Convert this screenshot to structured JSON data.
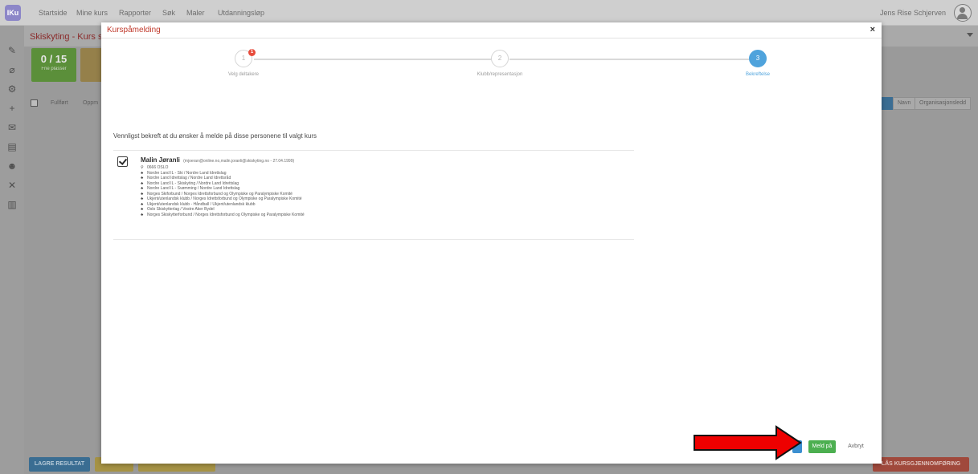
{
  "app": {
    "logo": "IKu",
    "nav": [
      "Startside",
      "Mine kurs",
      "Rapporter",
      "Søk",
      "Maler",
      "Utdanningsløp"
    ],
    "user_name": "Jens Rise Schjerven",
    "course_title": "Skiskyting - Kurs sikk"
  },
  "background": {
    "stat_value": "0 / 15",
    "stat_label": "Frie plasser",
    "filters": [
      "Fullført",
      "Oppm"
    ],
    "right_filters": [
      "Navn",
      "Organisasjonsledd"
    ],
    "save_button": "LAGRE RESULTAT",
    "lock_button": "LÅS KURSGJENNOMFØRING"
  },
  "modal": {
    "title": "Kurspåmelding",
    "close": "×",
    "steps": [
      {
        "number": "1",
        "label": "Velg deltakere",
        "badge": "1",
        "active": false
      },
      {
        "number": "2",
        "label": "Klubb/representasjon",
        "active": false
      },
      {
        "number": "3",
        "label": "Bekreftelse",
        "active": true
      }
    ],
    "confirm_text": "Vennligst bekreft at du ønsker å melde på disse personene til valgt kurs",
    "person": {
      "name": "Malin Jøranli",
      "meta": "(mjoeran@online.no,malin.joranli@skiskyting.no - 27.04.1999)",
      "address": "0666 OSLO",
      "memberships": [
        "Nordre Land IL - Ski / Nordre Land Idrettslag",
        "Nordre Land Idrettslag / Nordre Land Idrettsråd",
        "Nordre Land IL - Skiskyting / Nordre Land Idrettslag",
        "Nordre Land IL - Svømming / Nordre Land Idrettslag",
        "Norges Skiforbund / Norges Idrettsforbund og Olympiske og Paralympiske Komité",
        "Ukjent/utenlandsk klubb / Norges Idrettsforbund og Olympiske og Paralympiske Komité",
        "Ukjent/utenlandsk klubb - Håndball / Ukjent/utenlandsk klubb",
        "Oslo Skiskytterlag / Vestre Aker Bydel",
        "Norges Skiskytterforbund / Norges Idrettsforbund og Olympiske og Paralympiske Komité"
      ]
    },
    "buttons": {
      "primary": "Meld på",
      "cancel": "Avbryt"
    }
  },
  "colors": {
    "accent_blue": "#4fa3dc",
    "green": "#4caf50",
    "title_red": "#c0392b",
    "arrow_red": "#ee0000"
  }
}
